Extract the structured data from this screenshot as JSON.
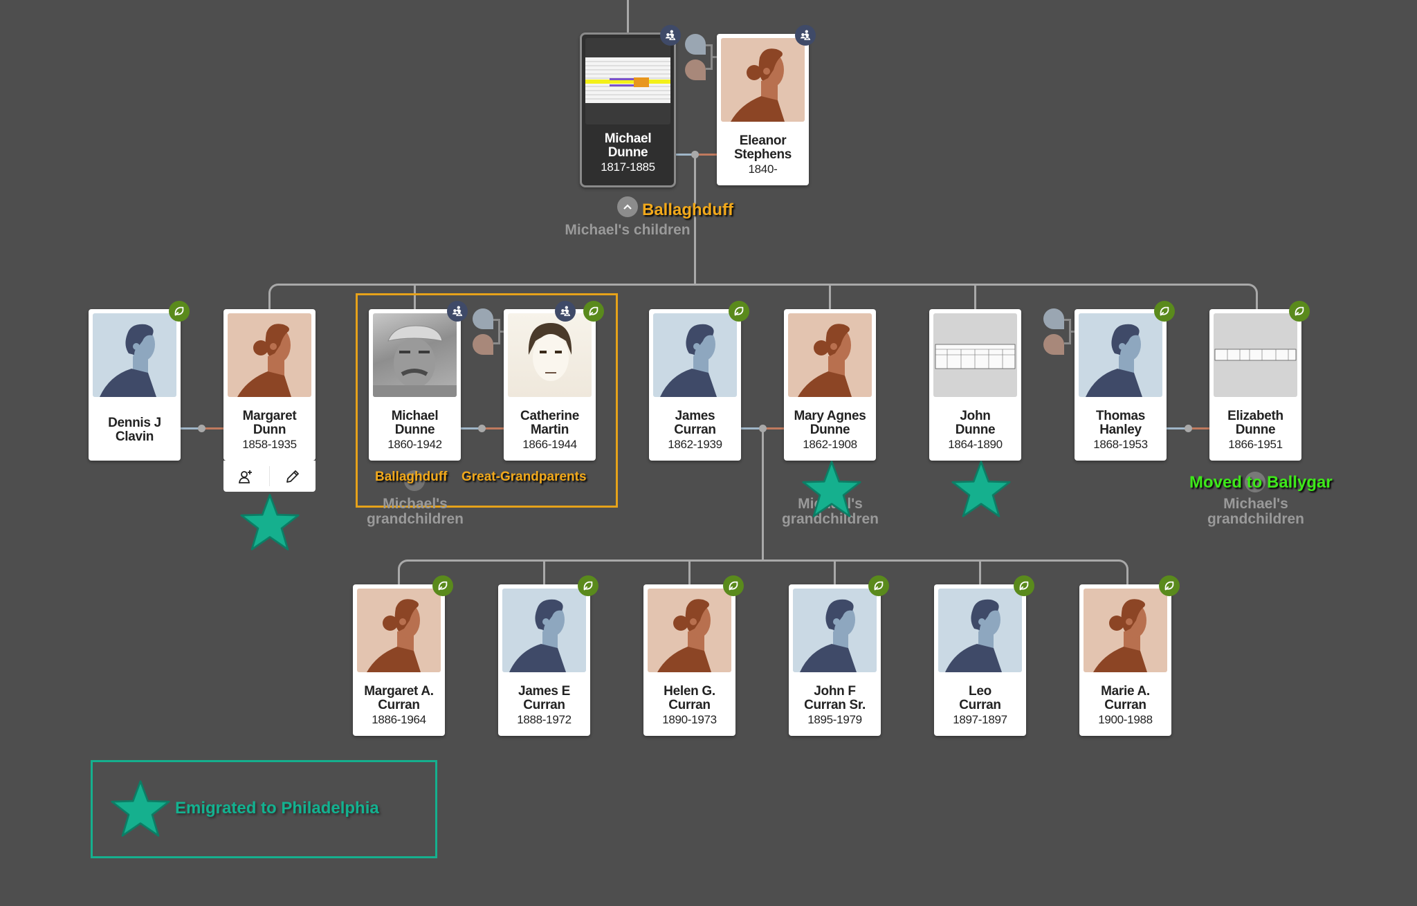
{
  "app": {
    "view": "family-tree"
  },
  "colors": {
    "background": "#4e4e4e",
    "hint_badge": "#5a8a1c",
    "family_badge": "#3f4a68",
    "highlight": "#e6a21a",
    "emigrated_star": "#15b08e",
    "moved_label": "#3ee81a"
  },
  "root_couple": {
    "husband": {
      "first": "Michael",
      "last": "Dunne",
      "years": "1817-1885",
      "photo": "document-spreadsheet",
      "badge": "family-icon",
      "selected": true
    },
    "wife": {
      "first": "Eleanor",
      "last": "Stephens",
      "years": "1840-",
      "photo": "female-silhouette",
      "badge": "family-icon"
    },
    "annotation": "Ballaghduff",
    "children_label": "Michael's children"
  },
  "children_row": [
    {
      "first": "Dennis J",
      "last": "Clavin",
      "years": "",
      "photo": "male-silhouette",
      "badge": "hint-icon"
    },
    {
      "first": "Margaret",
      "last": "Dunn",
      "years": "1858-1935",
      "photo": "female-silhouette",
      "badge": "",
      "toolbar": [
        "add-person-icon",
        "edit-pencil-icon"
      ],
      "emigrated": true
    },
    {
      "first": "Michael",
      "last": "Dunne",
      "years": "1860-1942",
      "photo": "old-photo-man",
      "badge": "family-icon"
    },
    {
      "first": "Catherine",
      "last": "Martin",
      "years": "1866-1944",
      "photo": "old-photo-woman",
      "badge": "family-icon",
      "badge2": "hint-icon"
    },
    {
      "first": "James",
      "last": "Curran",
      "years": "1862-1939",
      "photo": "male-silhouette",
      "badge": "hint-icon"
    },
    {
      "first": "Mary Agnes",
      "last": "Dunne",
      "years": "1862-1908",
      "photo": "female-silhouette",
      "badge": "",
      "emigrated": true
    },
    {
      "first": "John",
      "last": "Dunne",
      "years": "1864-1890",
      "photo": "document-record",
      "badge": "",
      "emigrated": true
    },
    {
      "first": "Thomas",
      "last": "Hanley",
      "years": "1868-1953",
      "photo": "male-silhouette",
      "badge": "hint-icon"
    },
    {
      "first": "Elizabeth",
      "last": "Dunne",
      "years": "1866-1951",
      "photo": "document-record",
      "badge": "hint-icon"
    }
  ],
  "highlight_group": {
    "labels": [
      "Ballaghduff",
      "Great-Grandparents"
    ]
  },
  "grandchildren_label": "Michael's grandchildren",
  "moved_annotation": "Moved to Ballygar",
  "grandchildren_row": [
    {
      "first": "Margaret A.",
      "last": "Curran",
      "years": "1886-1964",
      "photo": "female-silhouette",
      "badge": "hint-icon"
    },
    {
      "first": "James E",
      "last": "Curran",
      "years": "1888-1972",
      "photo": "male-silhouette",
      "badge": "hint-icon"
    },
    {
      "first": "Helen G.",
      "last": "Curran",
      "years": "1890-1973",
      "photo": "female-silhouette",
      "badge": "hint-icon"
    },
    {
      "first": "John F",
      "last": "Curran Sr.",
      "years": "1895-1979",
      "photo": "male-silhouette",
      "badge": "hint-icon"
    },
    {
      "first": "Leo",
      "last": "Curran",
      "years": "1897-1897",
      "photo": "male-silhouette",
      "badge": "hint-icon"
    },
    {
      "first": "Marie A.",
      "last": "Curran",
      "years": "1900-1988",
      "photo": "female-silhouette",
      "badge": "hint-icon"
    }
  ],
  "legend": {
    "icon": "star-icon",
    "label": "Emigrated to Philadelphia"
  }
}
